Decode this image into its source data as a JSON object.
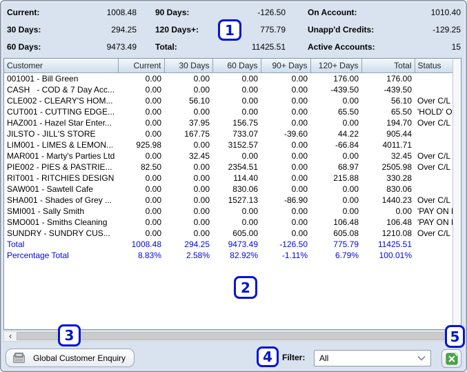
{
  "summary": {
    "columns": [
      {
        "items": [
          {
            "label": "Current:",
            "value": "1008.48"
          },
          {
            "label": "30 Days:",
            "value": "294.25"
          },
          {
            "label": "60 Days:",
            "value": "9473.49"
          }
        ]
      },
      {
        "items": [
          {
            "label": "90 Days:",
            "value": "-126.50"
          },
          {
            "label": "120 Days+:",
            "value": "775.79"
          },
          {
            "label": "Total:",
            "value": "11425.51"
          }
        ]
      },
      {
        "items": [
          {
            "label": "On Account:",
            "value": "1010.40"
          },
          {
            "label": "Unapp'd Credits:",
            "value": "-129.25"
          },
          {
            "label": "Active Accounts:",
            "value": "15"
          }
        ]
      }
    ]
  },
  "table": {
    "columns": [
      {
        "label": "Customer",
        "align": "left"
      },
      {
        "label": "Current",
        "align": "right"
      },
      {
        "label": "30 Days",
        "align": "right"
      },
      {
        "label": "60 Days",
        "align": "right"
      },
      {
        "label": "90+ Days",
        "align": "right"
      },
      {
        "label": "120+ Days",
        "align": "right"
      },
      {
        "label": "Total",
        "align": "right"
      },
      {
        "label": "Status",
        "align": "left"
      }
    ],
    "rows": [
      [
        "001001 - Bill Green",
        "0.00",
        "0.00",
        "0.00",
        "0.00",
        "176.00",
        "176.00",
        ""
      ],
      [
        "CASH   - COD & 7 Day Acc...",
        "0.00",
        "0.00",
        "0.00",
        "0.00",
        "-439.50",
        "-439.50",
        ""
      ],
      [
        "CLE002 - CLEARY'S HOM...",
        "0.00",
        "56.10",
        "0.00",
        "0.00",
        "0.00",
        "56.10",
        "Over C/L"
      ],
      [
        "CUT001 - CUTTING EDGE...",
        "0.00",
        "0.00",
        "0.00",
        "0.00",
        "65.50",
        "65.50",
        "'HOLD' Over"
      ],
      [
        "HAZ001 - Hazel Star Enter...",
        "0.00",
        "37.95",
        "156.75",
        "0.00",
        "0.00",
        "194.70",
        "Over C/L"
      ],
      [
        "JILSTO - JILL'S STORE",
        "0.00",
        "167.75",
        "733.07",
        "-39.60",
        "44.22",
        "905.44",
        ""
      ],
      [
        "LIM001 - LIMES & LEMON...",
        "925.98",
        "0.00",
        "3152.57",
        "0.00",
        "-66.84",
        "4011.71",
        ""
      ],
      [
        "MAR001 - Marty's Parties Ltd",
        "0.00",
        "32.45",
        "0.00",
        "0.00",
        "0.00",
        "32.45",
        "Over C/L"
      ],
      [
        "PIE002 - PIES & PASTRIE...",
        "82.50",
        "0.00",
        "2354.51",
        "0.00",
        "68.97",
        "2505.98",
        "Over C/L"
      ],
      [
        "RIT001 - RITCHIES DESIGN",
        "0.00",
        "0.00",
        "114.40",
        "0.00",
        "215.88",
        "330.28",
        ""
      ],
      [
        "SAW001 - Sawtell Cafe",
        "0.00",
        "0.00",
        "830.06",
        "0.00",
        "0.00",
        "830.06",
        ""
      ],
      [
        "SHA001 - Shades of Grey ...",
        "0.00",
        "0.00",
        "1527.13",
        "-86.90",
        "0.00",
        "1440.23",
        "Over C/L"
      ],
      [
        "SMI001 - Sally Smith",
        "0.00",
        "0.00",
        "0.00",
        "0.00",
        "0.00",
        "0.00",
        "'PAY ON PIC"
      ],
      [
        "SMO001 - Smiths Cleaning",
        "0.00",
        "0.00",
        "0.00",
        "0.00",
        "106.48",
        "106.48",
        "'PAY ON PIC"
      ],
      [
        "SUNDRY - SUNDRY CUS...",
        "0.00",
        "0.00",
        "605.00",
        "0.00",
        "605.08",
        "1210.08",
        "Over C/L"
      ]
    ],
    "total_row": [
      "Total",
      "1008.48",
      "294.25",
      "9473.49",
      "-126.50",
      "775.79",
      "11425.51",
      ""
    ],
    "percentage_row": [
      "Percentage Total",
      "8.83%",
      "2.58%",
      "82.92%",
      "-1.11%",
      "6.79%",
      "100.01%",
      ""
    ]
  },
  "annotations": [
    "1",
    "2",
    "3",
    "4",
    "5"
  ],
  "footer": {
    "enquiry_button_label": "Global Customer Enquiry",
    "filter_label": "Filter:",
    "filter_value": "All"
  },
  "icons": {
    "enquiry_button": "cash-register-icon",
    "excel_button": "excel-export-icon",
    "filter_dropdown": "chevron-down-icon",
    "hscroll_left": "chevron-left-icon"
  },
  "colors": {
    "annotation_blue": "#0016d0",
    "totals_text_blue": "#0008dd",
    "excel_green": "#4aa648",
    "window_background": "#d9e3ef",
    "header_gradient_top": "#f3f8fc",
    "header_gradient_bottom": "#cddded"
  }
}
